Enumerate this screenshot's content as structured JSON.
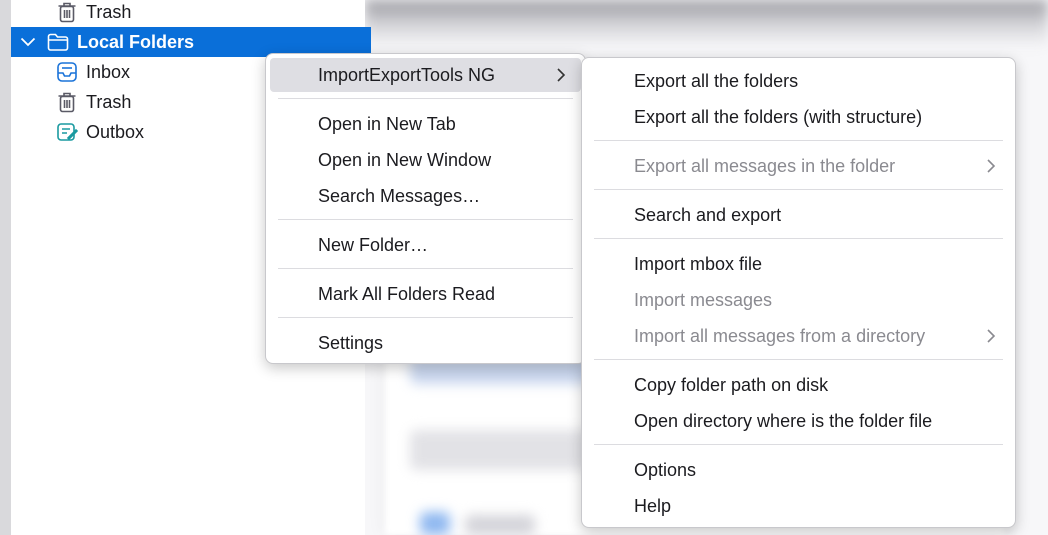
{
  "folder_tree": {
    "items": [
      {
        "label": "Trash",
        "icon": "trash-icon",
        "level": 2,
        "selected": false
      },
      {
        "label": "Local Folders",
        "icon": "folder-icon",
        "level": 1,
        "selected": true,
        "expanded": true
      },
      {
        "label": "Inbox",
        "icon": "inbox-icon",
        "level": 2,
        "selected": false
      },
      {
        "label": "Trash",
        "icon": "trash-icon",
        "level": 2,
        "selected": false
      },
      {
        "label": "Outbox",
        "icon": "outbox-icon",
        "level": 2,
        "selected": false
      }
    ]
  },
  "context_menu": {
    "items": [
      {
        "label": "ImportExportTools NG",
        "has_submenu": true,
        "active": true
      },
      {
        "label": "Open in New Tab"
      },
      {
        "label": "Open in New Window"
      },
      {
        "label": "Search Messages…"
      },
      {
        "label": "New Folder…"
      },
      {
        "label": "Mark All Folders Read"
      },
      {
        "label": "Settings"
      }
    ]
  },
  "submenu": {
    "items": [
      {
        "label": "Export all the folders"
      },
      {
        "label": "Export all the folders (with structure)"
      },
      {
        "label": "Export all messages in the folder",
        "disabled": true,
        "has_submenu": true
      },
      {
        "label": "Search and export"
      },
      {
        "label": "Import mbox file"
      },
      {
        "label": "Import messages",
        "disabled": true
      },
      {
        "label": "Import all messages from a directory",
        "disabled": true,
        "has_submenu": true
      },
      {
        "label": "Copy folder path on disk"
      },
      {
        "label": "Open directory where is the folder file"
      },
      {
        "label": "Options"
      },
      {
        "label": "Help"
      }
    ]
  },
  "colors": {
    "selection": "#0a6fd9",
    "menu_active": "#dedee3",
    "disabled_text": "#8a8a90",
    "icon_blue": "#1a73d9",
    "icon_teal": "#1a9aa0",
    "icon_gray": "#5a5a66"
  }
}
